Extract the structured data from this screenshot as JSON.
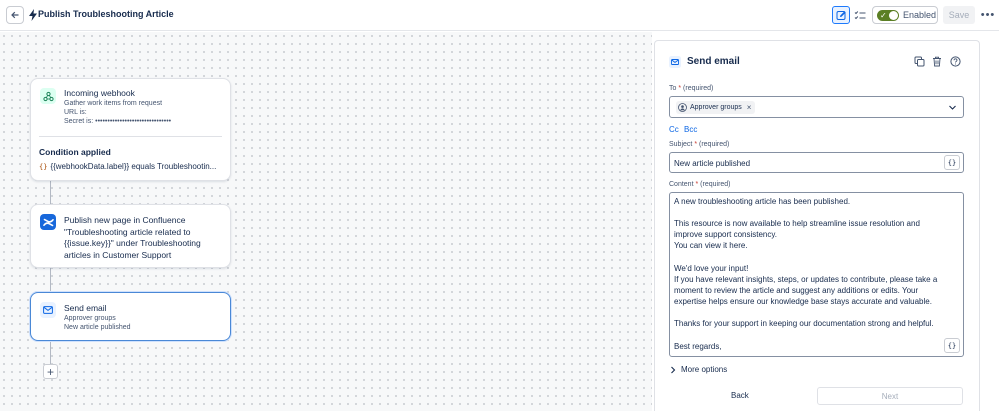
{
  "header": {
    "title": "Publish Troubleshooting Article",
    "enabled_label": "Enabled",
    "save_label": "Save",
    "more_label": "•••"
  },
  "canvas": {
    "trigger": {
      "title": "Incoming webhook",
      "lines": [
        "Gather work items from request",
        "URL is:",
        "Secret is: •••••••••••••••••••••••••••••••"
      ],
      "condition_title": "Condition applied",
      "condition_text": "{{webhookData.label}} equals Troubleshootin...",
      "braces": "{}"
    },
    "confluence": {
      "text": "Publish new page in Confluence \"Troubleshooting article related to {{issue.key}}\" under Troubleshooting articles in Customer Support"
    },
    "email": {
      "title": "Send email",
      "lines": [
        "Approver groups",
        "New article published"
      ]
    },
    "add_label": "+"
  },
  "panel": {
    "title": "Send email",
    "to_label": "To",
    "subject_label": "Subject",
    "content_label": "Content",
    "required_note": "(required)",
    "star": "*",
    "to_chip": "Approver groups",
    "chip_remove": "×",
    "cc_label": "Cc",
    "bcc_label": "Bcc",
    "subject_value": "New article published",
    "var_icon": "{}",
    "content_lines": [
      "A new troubleshooting article has been published.",
      "",
      "This resource is now available to help streamline issue resolution and",
      "improve support consistency.",
      "You can view it here.",
      "",
      "We'd love your input!",
      "If you have relevant insights, steps, or updates to contribute, please take a",
      "moment to review the article and suggest any additions or edits. Your",
      "expertise helps ensure our knowledge base stays accurate and valuable.",
      "",
      "Thanks for your support in keeping our documentation strong and helpful.",
      "",
      "Best regards,"
    ],
    "more_options": "More options",
    "back_label": "Back",
    "next_label": "Next"
  },
  "colors": {
    "accent": "#0c66e4",
    "toggle_on": "#5b7f24",
    "confluence": "#1868db",
    "selected_border": "#4a88d6"
  },
  "icons": [
    "back-arrow-icon",
    "lightning-icon",
    "edit-icon",
    "checklist-icon",
    "webhook-icon",
    "confluence-icon",
    "mail-icon",
    "duplicate-icon",
    "trash-icon",
    "help-icon",
    "group-icon",
    "chevron-down-icon",
    "chevron-right-icon"
  ]
}
